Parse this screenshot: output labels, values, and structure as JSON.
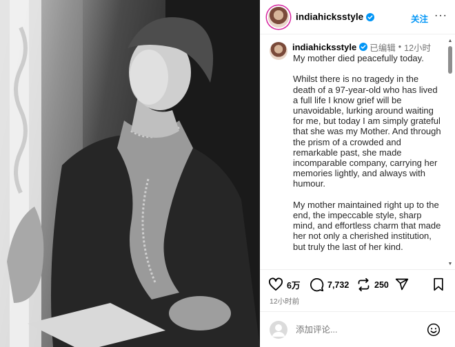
{
  "post": {
    "username": "indiahicksstyle",
    "follow_label": "关注",
    "more_label": "···"
  },
  "caption": {
    "username": "indiahicksstyle",
    "edited_label": "已编辑",
    "separator": "•",
    "age": "12小时",
    "paragraphs": [
      "My mother died peacefully today.",
      "Whilst there is no tragedy in the death of a 97-year-old who has lived a full life I know grief will be unavoidable, lurking around waiting for me, but today I am simply grateful that she was my Mother. And through the prism of a crowded and remarkable past, she made incomparable company, carrying her memories lightly, and always with humour.",
      "My mother maintained right up to the end, the impeccable style, sharp mind, and effortless charm that made her not only a cherished institution, but truly the last of her kind."
    ]
  },
  "actions": {
    "likes": "6万",
    "comments": "7,732",
    "reposts": "250"
  },
  "timestamp": "12小时前",
  "comment": {
    "placeholder": "添加评论..."
  },
  "colors": {
    "follow": "#0095f6",
    "verified": "#0095f6",
    "muted": "#737373"
  },
  "icons": [
    "verified-badge-icon",
    "more-icon",
    "heart-icon",
    "comment-icon",
    "repost-icon",
    "share-icon",
    "bookmark-icon",
    "emoji-icon",
    "scroll-up-icon",
    "scroll-down-icon"
  ]
}
